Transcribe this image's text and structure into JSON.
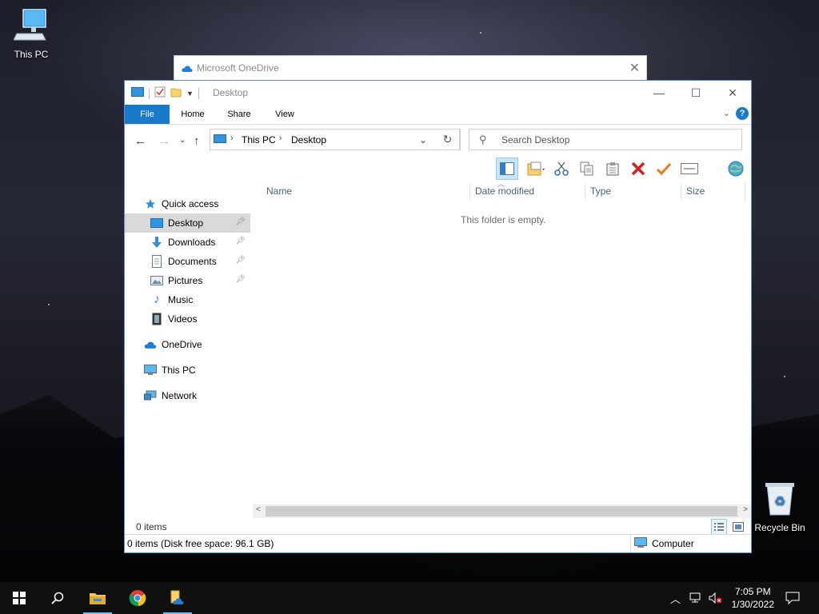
{
  "desktop": {
    "this_pc_label": "This PC",
    "recycle_bin_label": "Recycle Bin"
  },
  "onedrive_window": {
    "title": "Microsoft OneDrive",
    "close": "✕"
  },
  "explorer": {
    "title": "Desktop",
    "ribbon_tabs": [
      "File",
      "Home",
      "Share",
      "View"
    ],
    "help": "?",
    "address": {
      "crumbs": [
        "This PC",
        "Desktop"
      ]
    },
    "search": {
      "placeholder": "Search Desktop"
    },
    "columns": [
      "Name",
      "Date modified",
      "Type",
      "Size"
    ],
    "empty_message": "This folder is empty.",
    "nav": {
      "quick_access": "Quick access",
      "desktop": "Desktop",
      "downloads": "Downloads",
      "documents": "Documents",
      "pictures": "Pictures",
      "music": "Music",
      "videos": "Videos",
      "onedrive": "OneDrive",
      "this_pc": "This PC",
      "network": "Network"
    },
    "item_count": "0 items",
    "status_left": "0 items (Disk free space: 96.1 GB)",
    "status_right": "Computer"
  },
  "taskbar": {
    "time": "7:05 PM",
    "date": "1/30/2022"
  },
  "colors": {
    "accent": "#1979ca",
    "selection": "#cce4f7",
    "taskbar": "#101010"
  }
}
